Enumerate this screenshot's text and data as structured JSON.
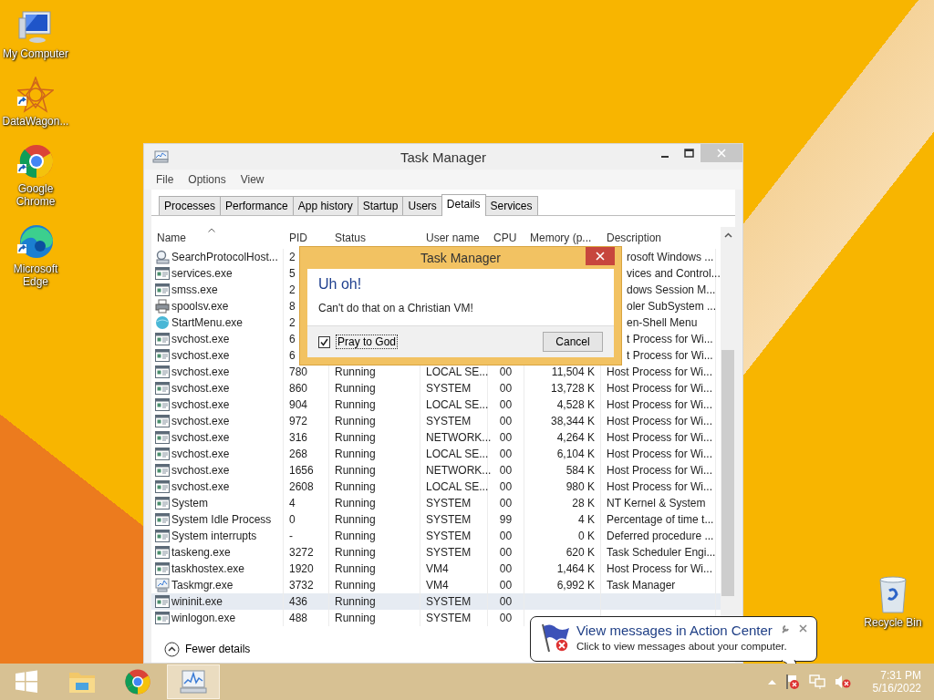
{
  "desktop_icons": [
    {
      "label": "My Computer",
      "kind": "computer"
    },
    {
      "label": "DataWagon...",
      "kind": "star"
    },
    {
      "label": "Google\nChrome",
      "kind": "chrome"
    },
    {
      "label": "Microsoft\nEdge",
      "kind": "edge"
    }
  ],
  "recycle_bin": {
    "label": "Recycle Bin"
  },
  "window": {
    "title": "Task Manager",
    "menu": [
      "File",
      "Options",
      "View"
    ],
    "tabs": [
      {
        "label": "Processes",
        "selected": false
      },
      {
        "label": "Performance",
        "selected": false
      },
      {
        "label": "App history",
        "selected": false
      },
      {
        "label": "Startup",
        "selected": false
      },
      {
        "label": "Users",
        "selected": false
      },
      {
        "label": "Details",
        "selected": true
      },
      {
        "label": "Services",
        "selected": false
      }
    ],
    "table": {
      "columns": [
        "Name",
        "PID",
        "Status",
        "User name",
        "CPU",
        "Memory (p...",
        "Description"
      ],
      "rows": [
        {
          "kind": "search",
          "selected": false,
          "name": "SearchProtocolHost...",
          "pid": "2",
          "description": "rosoft Windows ..."
        },
        {
          "kind": "app",
          "selected": false,
          "name": "services.exe",
          "pid": "5",
          "description": "vices and Control..."
        },
        {
          "kind": "app",
          "selected": false,
          "name": "smss.exe",
          "pid": "2",
          "description": "dows Session M..."
        },
        {
          "kind": "printer",
          "selected": false,
          "name": "spoolsv.exe",
          "pid": "8",
          "description": "oler SubSystem ..."
        },
        {
          "kind": "globe",
          "selected": false,
          "name": "StartMenu.exe",
          "pid": "2",
          "description": "en-Shell Menu"
        },
        {
          "kind": "app",
          "selected": false,
          "name": "svchost.exe",
          "pid": "6",
          "description": "t Process for Wi..."
        },
        {
          "kind": "app",
          "selected": false,
          "name": "svchost.exe",
          "pid": "6",
          "description": "t Process for Wi..."
        },
        {
          "kind": "app",
          "selected": false,
          "name": "svchost.exe",
          "pid": "780",
          "status": "Running",
          "user": "LOCAL SE...",
          "cpu": "00",
          "memory": "11,504 K",
          "description": "Host Process for Wi..."
        },
        {
          "kind": "app",
          "selected": false,
          "name": "svchost.exe",
          "pid": "860",
          "status": "Running",
          "user": "SYSTEM",
          "cpu": "00",
          "memory": "13,728 K",
          "description": "Host Process for Wi..."
        },
        {
          "kind": "app",
          "selected": false,
          "name": "svchost.exe",
          "pid": "904",
          "status": "Running",
          "user": "LOCAL SE...",
          "cpu": "00",
          "memory": "4,528 K",
          "description": "Host Process for Wi..."
        },
        {
          "kind": "app",
          "selected": false,
          "name": "svchost.exe",
          "pid": "972",
          "status": "Running",
          "user": "SYSTEM",
          "cpu": "00",
          "memory": "38,344 K",
          "description": "Host Process for Wi..."
        },
        {
          "kind": "app",
          "selected": false,
          "name": "svchost.exe",
          "pid": "316",
          "status": "Running",
          "user": "NETWORK...",
          "cpu": "00",
          "memory": "4,264 K",
          "description": "Host Process for Wi..."
        },
        {
          "kind": "app",
          "selected": false,
          "name": "svchost.exe",
          "pid": "268",
          "status": "Running",
          "user": "LOCAL SE...",
          "cpu": "00",
          "memory": "6,104 K",
          "description": "Host Process for Wi..."
        },
        {
          "kind": "app",
          "selected": false,
          "name": "svchost.exe",
          "pid": "1656",
          "status": "Running",
          "user": "NETWORK...",
          "cpu": "00",
          "memory": "584 K",
          "description": "Host Process for Wi..."
        },
        {
          "kind": "app",
          "selected": false,
          "name": "svchost.exe",
          "pid": "2608",
          "status": "Running",
          "user": "LOCAL SE...",
          "cpu": "00",
          "memory": "980 K",
          "description": "Host Process for Wi..."
        },
        {
          "kind": "app",
          "selected": false,
          "name": "System",
          "pid": "4",
          "status": "Running",
          "user": "SYSTEM",
          "cpu": "00",
          "memory": "28 K",
          "description": "NT Kernel & System"
        },
        {
          "kind": "app",
          "selected": false,
          "name": "System Idle Process",
          "pid": "0",
          "status": "Running",
          "user": "SYSTEM",
          "cpu": "99",
          "memory": "4 K",
          "description": "Percentage of time t..."
        },
        {
          "kind": "app",
          "selected": false,
          "name": "System interrupts",
          "pid": "-",
          "status": "Running",
          "user": "SYSTEM",
          "cpu": "00",
          "memory": "0 K",
          "description": "Deferred procedure ..."
        },
        {
          "kind": "app",
          "selected": false,
          "name": "taskeng.exe",
          "pid": "3272",
          "status": "Running",
          "user": "SYSTEM",
          "cpu": "00",
          "memory": "620 K",
          "description": "Task Scheduler Engi..."
        },
        {
          "kind": "app",
          "selected": false,
          "name": "taskhostex.exe",
          "pid": "1920",
          "status": "Running",
          "user": "VM4",
          "cpu": "00",
          "memory": "1,464 K",
          "description": "Host Process for Wi..."
        },
        {
          "kind": "monitor",
          "selected": false,
          "name": "Taskmgr.exe",
          "pid": "3732",
          "status": "Running",
          "user": "VM4",
          "cpu": "00",
          "memory": "6,992 K",
          "description": "Task Manager"
        },
        {
          "kind": "app",
          "selected": true,
          "name": "wininit.exe",
          "pid": "436",
          "status": "Running",
          "user": "SYSTEM",
          "cpu": "00"
        },
        {
          "kind": "app",
          "selected": false,
          "name": "winlogon.exe",
          "pid": "488",
          "status": "Running",
          "user": "SYSTEM",
          "cpu": "00"
        }
      ]
    },
    "footer": "Fewer details"
  },
  "dialog": {
    "title": "Task Manager",
    "heading": "Uh oh!",
    "message": "Can't do that on a Christian VM!",
    "checkbox": {
      "label": "Pray to God",
      "checked": true
    },
    "button": "Cancel"
  },
  "notification": {
    "title": "View messages in Action Center",
    "body": "Click to view messages about your computer."
  },
  "taskbar": {
    "apps": [
      {
        "kind": "explorer",
        "selected": false
      },
      {
        "kind": "chrome",
        "selected": false
      },
      {
        "kind": "taskmgr",
        "selected": true
      }
    ],
    "time": "7:31 PM",
    "date": "5/16/2022"
  }
}
